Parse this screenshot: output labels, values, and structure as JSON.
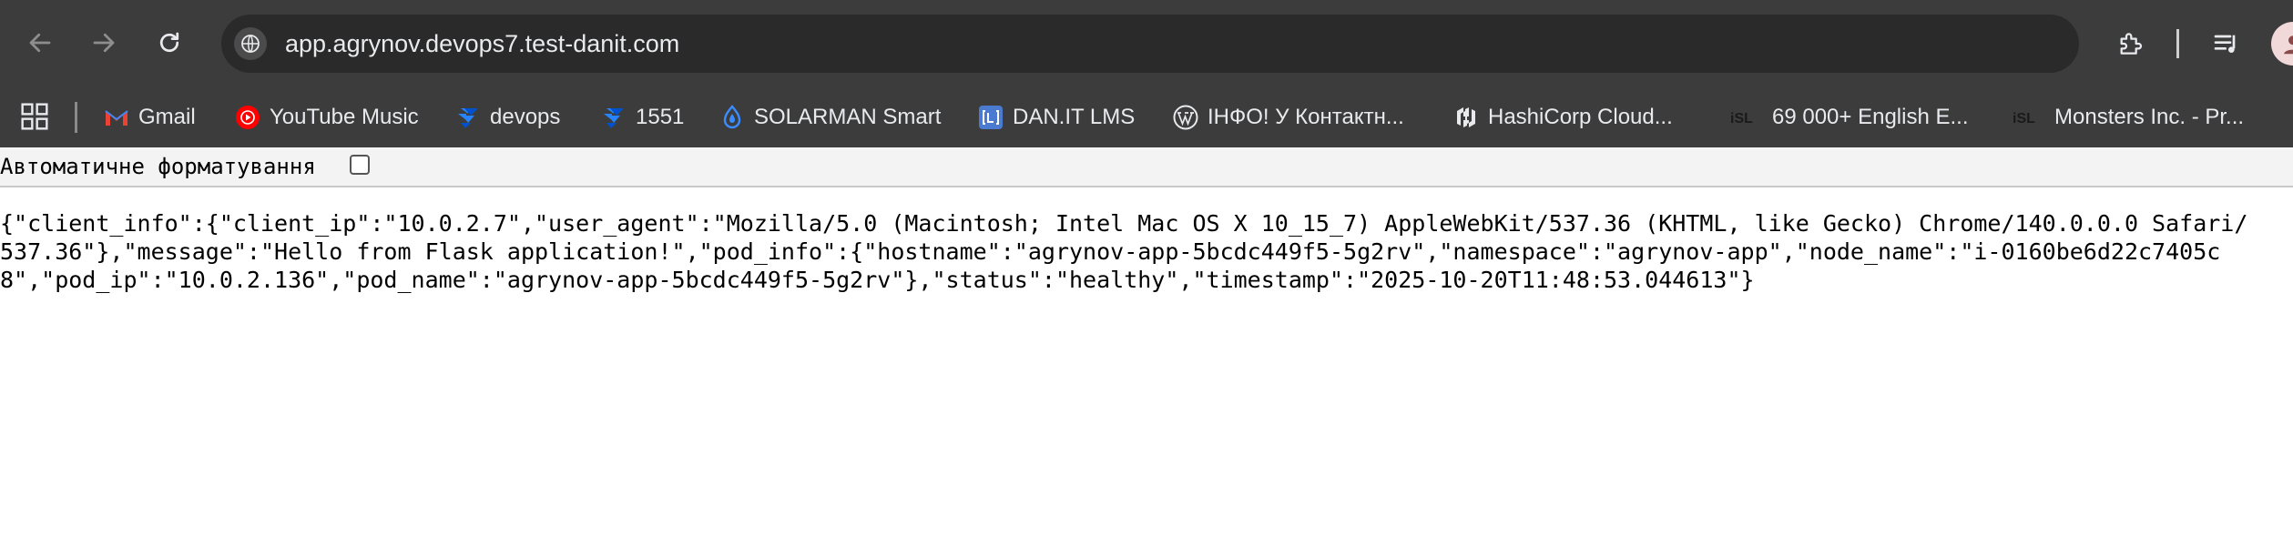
{
  "browser": {
    "url": "app.agrynov.devops7.test-danit.com",
    "icons": {
      "back": "back-arrow-icon",
      "forward": "forward-arrow-icon",
      "reload": "reload-icon",
      "site_info": "site-info-icon",
      "extensions": "extensions-puzzle-icon",
      "media": "media-queue-icon",
      "profile": "profile-avatar-icon"
    }
  },
  "bookmarks": {
    "apps_icon": "apps-grid-icon",
    "items": [
      {
        "label": "Gmail",
        "icon": "gmail-icon"
      },
      {
        "label": "YouTube Music",
        "icon": "youtube-music-icon"
      },
      {
        "label": "devops",
        "icon": "jira-icon"
      },
      {
        "label": "1551",
        "icon": "jira-icon"
      },
      {
        "label": "SOLARMAN Smart",
        "icon": "solarman-icon"
      },
      {
        "label": "DAN.IT LMS",
        "icon": "lms-icon"
      },
      {
        "label": "ІНФО! У Контактн...",
        "icon": "wordpress-icon"
      },
      {
        "label": "HashiCorp Cloud...",
        "icon": "hashicorp-icon"
      },
      {
        "label": "69 000+ English E...",
        "icon": "isl-icon"
      },
      {
        "label": "Monsters Inc. - Pr...",
        "icon": "isl-icon"
      }
    ]
  },
  "page": {
    "pretty_print_label": "Автоматичне форматування",
    "pretty_print_checked": false,
    "json_text": "{\"client_info\":{\"client_ip\":\"10.0.2.7\",\"user_agent\":\"Mozilla/5.0 (Macintosh; Intel Mac OS X 10_15_7) AppleWebKit/537.36 (KHTML, like Gecko) Chrome/140.0.0.0 Safari/537.36\"},\"message\":\"Hello from Flask application!\",\"pod_info\":{\"hostname\":\"agrynov-app-5bcdc449f5-5g2rv\",\"namespace\":\"agrynov-app\",\"node_name\":\"i-0160be6d22c7405c8\",\"pod_ip\":\"10.0.2.136\",\"pod_name\":\"agrynov-app-5bcdc449f5-5g2rv\"},\"status\":\"healthy\",\"timestamp\":\"2025-10-20T11:48:53.044613\"}"
  },
  "colors": {
    "toolbar_bg": "#3c3c3c",
    "omnibox_bg": "#2a2a2a",
    "text_light": "#e8eaed",
    "page_bg": "#ffffff"
  }
}
